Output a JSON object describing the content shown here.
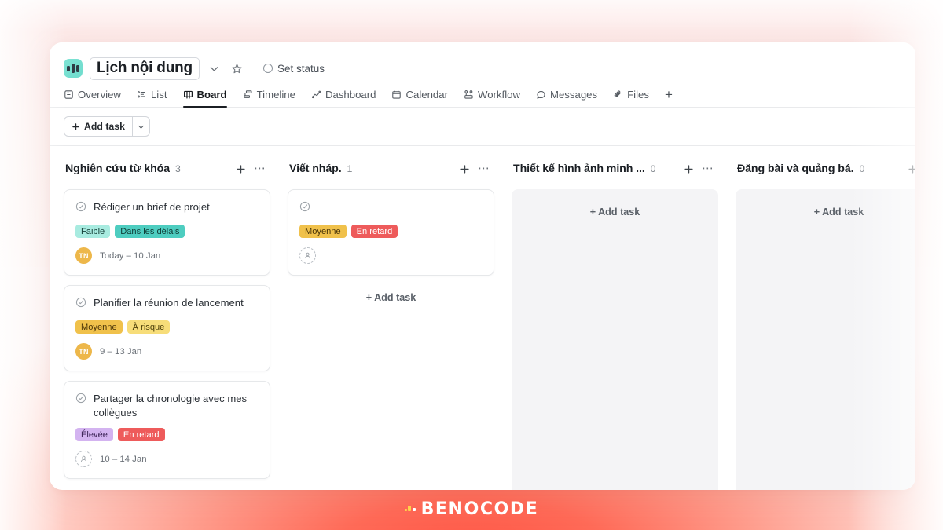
{
  "window": {
    "project_title": "Lịch nội dung",
    "set_status_label": "Set status"
  },
  "tabs": [
    {
      "label": "Overview",
      "icon": "overview-icon",
      "active": false
    },
    {
      "label": "List",
      "icon": "list-icon",
      "active": false
    },
    {
      "label": "Board",
      "icon": "board-icon",
      "active": true
    },
    {
      "label": "Timeline",
      "icon": "timeline-icon",
      "active": false
    },
    {
      "label": "Dashboard",
      "icon": "dashboard-icon",
      "active": false
    },
    {
      "label": "Calendar",
      "icon": "calendar-icon",
      "active": false
    },
    {
      "label": "Workflow",
      "icon": "workflow-icon",
      "active": false
    },
    {
      "label": "Messages",
      "icon": "messages-icon",
      "active": false
    },
    {
      "label": "Files",
      "icon": "files-icon",
      "active": false
    }
  ],
  "tab_add_label": "+",
  "toolbar": {
    "add_task_label": "Add task"
  },
  "board": {
    "add_task_label": "+ Add task",
    "columns": [
      {
        "title": "Nghiên cứu từ khóa",
        "count": "3",
        "empty": false,
        "cards": [
          {
            "title": "Rédiger un brief de projet",
            "tags": [
              {
                "label": "Faible",
                "bg": "#a8ebe0",
                "fg": "#16423a"
              },
              {
                "label": "Dans les délais",
                "bg": "#4ecdc0",
                "fg": "#0f3b35"
              }
            ],
            "avatar": "TN",
            "avatar_color": "#edb74a",
            "date": "Today – 10 Jan"
          },
          {
            "title": "Planifier la réunion de lancement",
            "tags": [
              {
                "label": "Moyenne",
                "bg": "#f0c14b",
                "fg": "#4a3508"
              },
              {
                "label": "À risque",
                "bg": "#f7dd79",
                "fg": "#4a3d08"
              }
            ],
            "avatar": "TN",
            "avatar_color": "#edb74a",
            "date": "9 – 13 Jan"
          },
          {
            "title": "Partager la chronologie avec mes collègues",
            "tags": [
              {
                "label": "Élevée",
                "bg": "#d3b3f0",
                "fg": "#3b2355"
              },
              {
                "label": "En retard",
                "bg": "#ee5b5b",
                "fg": "#ffffff"
              }
            ],
            "avatar": "",
            "avatar_color": "",
            "date": "10 – 14 Jan"
          }
        ]
      },
      {
        "title": "Viết nháp.",
        "count": "1",
        "empty": false,
        "cards": [
          {
            "title": "",
            "tags": [
              {
                "label": "Moyenne",
                "bg": "#f0c14b",
                "fg": "#4a3508"
              },
              {
                "label": "En retard",
                "bg": "#ee5b5b",
                "fg": "#ffffff"
              }
            ],
            "avatar": "",
            "avatar_color": "",
            "date": ""
          }
        ]
      },
      {
        "title": "Thiết kế hình ảnh minh ...",
        "count": "0",
        "empty": true,
        "cards": []
      },
      {
        "title": "Đăng bài và quảng bá.",
        "count": "0",
        "empty": true,
        "cards": []
      }
    ]
  },
  "brand": {
    "text": "BENOCODE"
  }
}
